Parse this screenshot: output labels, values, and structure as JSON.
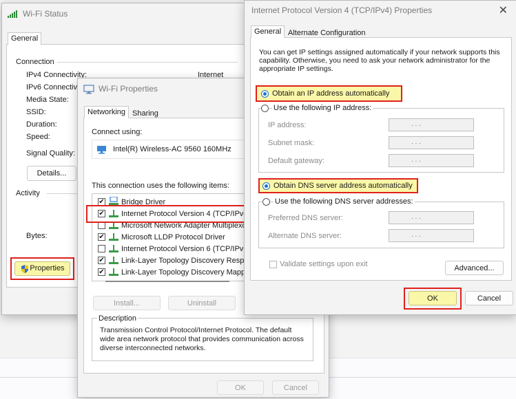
{
  "wifi_status": {
    "title": "Wi-Fi Status",
    "tab_general": "General",
    "connection_label": "Connection",
    "rows": [
      {
        "label": "IPv4 Connectivity:",
        "value": "Internet"
      },
      {
        "label": "IPv6 Connectivi",
        "value": ""
      },
      {
        "label": "Media State:",
        "value": ""
      },
      {
        "label": "SSID:",
        "value": ""
      },
      {
        "label": "Duration:",
        "value": ""
      },
      {
        "label": "Speed:",
        "value": ""
      }
    ],
    "signal_label": "Signal Quality:",
    "details_button": "Details...",
    "activity_label": "Activity",
    "bytes_label": "Bytes:",
    "properties_button": "Properties"
  },
  "wifi_properties": {
    "title": "Wi-Fi Properties",
    "tab_networking": "Networking",
    "tab_sharing": "Sharing",
    "connect_using_label": "Connect using:",
    "adapter_name": "Intel(R) Wireless-AC 9560 160MHz",
    "items_label": "This connection uses the following items:",
    "items": [
      {
        "label": "Bridge Driver",
        "checked": true
      },
      {
        "label": "Internet Protocol Version 4 (TCP/IPv4",
        "checked": true
      },
      {
        "label": "Microsoft Network Adapter Multiplexor",
        "checked": false
      },
      {
        "label": "Microsoft LLDP Protocol Driver",
        "checked": true
      },
      {
        "label": "Internet Protocol Version 6 (TCP/IPv6",
        "checked": false
      },
      {
        "label": "Link-Layer Topology Discovery Respo",
        "checked": true
      },
      {
        "label": "Link-Layer Topology Discovery Mappe",
        "checked": true
      }
    ],
    "install_button": "Install...",
    "uninstall_button": "Uninstall",
    "description_label": "Description",
    "description_text": "Transmission Control Protocol/Internet Protocol. The default wide area network protocol that provides communication across diverse interconnected networks.",
    "ok_button": "OK",
    "cancel_button": "Cancel"
  },
  "ipv4": {
    "title": "Internet Protocol Version 4 (TCP/IPv4) Properties",
    "tab_general": "General",
    "tab_alternate": "Alternate Configuration",
    "intro": "You can get IP settings assigned automatically if your network supports this capability. Otherwise, you need to ask your network administrator for the appropriate IP settings.",
    "obtain_ip_auto": "Obtain an IP address automatically",
    "use_following_ip": "Use the following IP address:",
    "ip_address_label": "IP address:",
    "subnet_mask_label": "Subnet mask:",
    "default_gateway_label": "Default gateway:",
    "obtain_dns_auto": "Obtain DNS server address automatically",
    "use_following_dns": "Use the following DNS server addresses:",
    "preferred_dns_label": "Preferred DNS server:",
    "alternate_dns_label": "Alternate DNS server:",
    "validate_label": "Validate settings upon exit",
    "advanced_button": "Advanced...",
    "ok_button": "OK",
    "cancel_button": "Cancel",
    "ip_dots": ".       .       ."
  },
  "colors": {
    "highlight_border": "#e0201b",
    "highlight_fill": "#fbf7a8",
    "accent": "#1a6fd1"
  }
}
